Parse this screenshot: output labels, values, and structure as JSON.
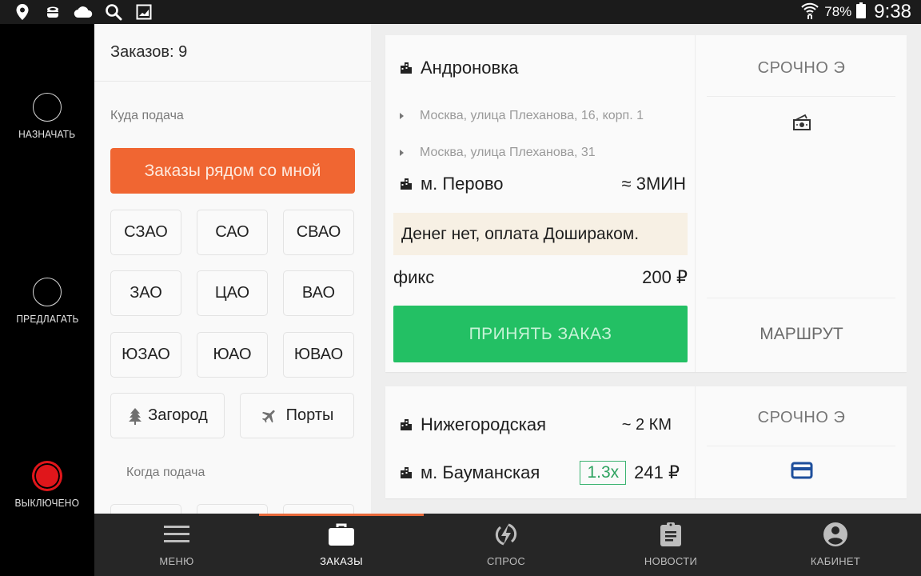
{
  "statusbar": {
    "left_icons": [
      "location-icon",
      "sushi-icon",
      "cloud-icon",
      "search-icon",
      "gallery-icon"
    ],
    "wifi_icon": "wifi-icon",
    "battery_percent": "78%",
    "battery_icon": "battery-icon",
    "time": "9:38"
  },
  "rail": {
    "items": [
      {
        "label": "НАЗНАЧАТЬ",
        "state": "off"
      },
      {
        "label": "ПРЕДЛАГАТЬ",
        "state": "off"
      },
      {
        "label": "ВЫКЛЮЧЕНО",
        "state": "on",
        "color": "#e0161b"
      }
    ]
  },
  "filters": {
    "orders_count_label": "Заказов: 9",
    "where_label": "Куда подача",
    "nearby_button": "Заказы рядом со мной",
    "nearby_color": "#f06632",
    "zones": [
      "СЗАО",
      "САО",
      "СВАО",
      "ЗАО",
      "ЦАО",
      "ВАО",
      "ЮЗАО",
      "ЮАО",
      "ЮВАО"
    ],
    "extra": [
      {
        "label": "Загород",
        "icon": "tree-icon"
      },
      {
        "label": "Порты",
        "icon": "airplane-icon"
      }
    ],
    "when_label": "Когда подача"
  },
  "orders": [
    {
      "pickup": "Андроновка",
      "waypoints": [
        "Москва, улица Плеханова, 16, корп. 1",
        "Москва, улица Плеханова, 31"
      ],
      "destination": "м. Перово",
      "eta": "≈ 3МИН",
      "comment": "Денег нет, оплата Дошираком.",
      "tariff": "фикс",
      "price": "200 ₽",
      "accept_label": "ПРИНЯТЬ ЗАКАЗ",
      "accept_color": "#23c064",
      "urgency": "СРОЧНО  Э",
      "payment_icon": "cash-icon",
      "route_label": "МАРШРУТ"
    },
    {
      "pickup": "Нижегородская",
      "distance": "~ 2 КМ",
      "destination": "м. Бауманская",
      "coefficient": "1.3x",
      "price": "241 ₽",
      "urgency": "СРОЧНО  Э",
      "payment_icon": "card-icon"
    }
  ],
  "bottom_nav": {
    "active_index": 1,
    "active_color": "#e8693a",
    "items": [
      {
        "label": "МЕНЮ",
        "icon": "menu-icon"
      },
      {
        "label": "ЗАКАЗЫ",
        "icon": "briefcase-icon"
      },
      {
        "label": "СПРОС",
        "icon": "lightning-icon"
      },
      {
        "label": "НОВОСТИ",
        "icon": "clipboard-icon"
      },
      {
        "label": "КАБИНЕТ",
        "icon": "account-icon"
      }
    ]
  }
}
